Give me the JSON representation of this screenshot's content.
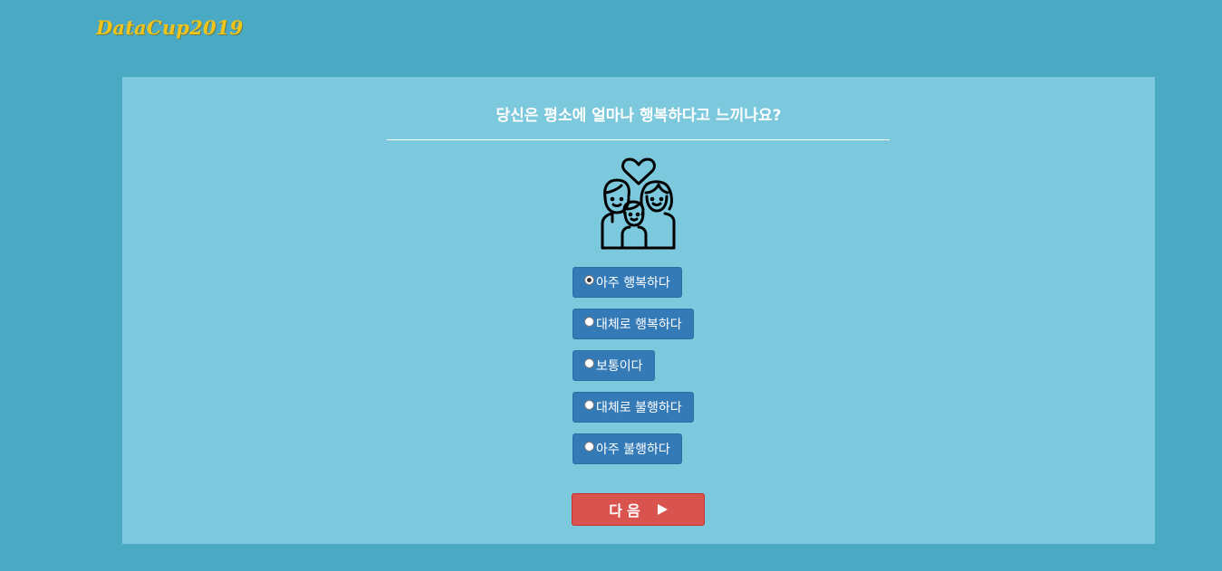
{
  "header": {
    "logo": "DataCup2019"
  },
  "survey": {
    "question": "당신은 평소에 얼마나 행복하다고 느끼나요?",
    "illustration_icon": "family-heart-icon",
    "options": [
      {
        "label": "아주 행복하다",
        "selected": true
      },
      {
        "label": "대체로 행복하다",
        "selected": false
      },
      {
        "label": "보통이다",
        "selected": false
      },
      {
        "label": "대체로 불행하다",
        "selected": false
      },
      {
        "label": "아주 불행하다",
        "selected": false
      }
    ],
    "next_label": "다음",
    "next_icon": "play-icon"
  },
  "colors": {
    "page_background": "#4aa9c3",
    "panel_background": "#7cc8dc",
    "logo": "#f0c419",
    "option_button": "#337ab7",
    "next_button": "#d9534f"
  }
}
